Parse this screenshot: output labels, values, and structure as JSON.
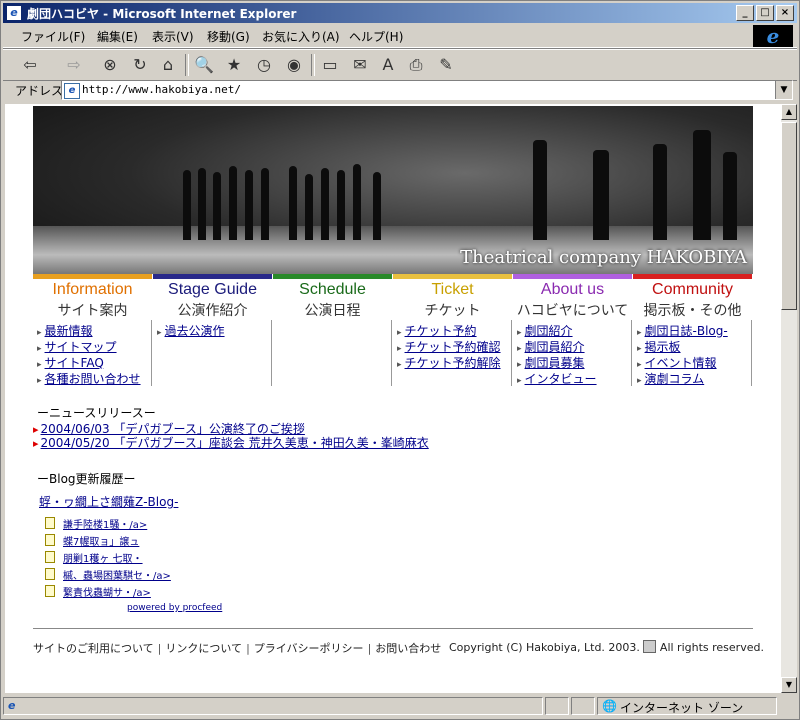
{
  "window": {
    "title": "劇団ハコビヤ - Microsoft Internet Explorer",
    "min_label": "_",
    "max_label": "□",
    "close_label": "×"
  },
  "menu": [
    "ファイル(F)",
    "編集(E)",
    "表示(V)",
    "移動(G)",
    "お気に入り(A)",
    "ヘルプ(H)"
  ],
  "address": {
    "label": "アドレス",
    "url": "http://www.hakobiya.net/"
  },
  "hero": {
    "caption": "Theatrical company HAKOBIYA"
  },
  "nav": [
    {
      "en": "Information",
      "jp": "サイト案内",
      "color": "#e07000",
      "bar": "#e8a020",
      "links": [
        "最新情報",
        "サイトマップ",
        "サイトFAQ",
        "各種お問い合わせ"
      ]
    },
    {
      "en": "Stage Guide",
      "jp": "公演作紹介",
      "color": "#1a1a7a",
      "bar": "#2a2a8a",
      "links": [
        "過去公演作"
      ]
    },
    {
      "en": "Schedule",
      "jp": "公演日程",
      "color": "#1a6a1a",
      "bar": "#2a8a2a",
      "links": []
    },
    {
      "en": "Ticket",
      "jp": "チケット",
      "color": "#c8a000",
      "bar": "#e8c040",
      "links": [
        "チケット予約",
        "チケット予約確認",
        "チケット予約解除"
      ]
    },
    {
      "en": "About us",
      "jp": "ハコビヤについて",
      "color": "#8a2ab0",
      "bar": "#b060e0",
      "links": [
        "劇団紹介",
        "劇団員紹介",
        "劇団員募集",
        "インタビュー"
      ]
    },
    {
      "en": "Community",
      "jp": "掲示板・その他",
      "color": "#c01010",
      "bar": "#d82020",
      "links": [
        "劇団日誌-Blog-",
        "掲示板",
        "イベント情報",
        "演劇コラム"
      ]
    }
  ],
  "news": {
    "heading": "ーニュースリリースー",
    "items": [
      "2004/06/03 「デパガブース」公演終了のご挨拶",
      "2004/05/20 「デパガブース」座談会  荒井久美恵・神田久美・峯崎麻衣"
    ]
  },
  "blog": {
    "heading": "ーBlog更新履歴ー",
    "title": "蜉・ヮ繝上さ繝薙Ζ-Blog-",
    "items": [
      "謙手陸楼1騒・/a>",
      "蝶7幄取ョ」譲ュ",
      "朋剿1穫ヶ 七取・",
      "槭、蟲場困葉騏セ・/a>",
      "繋責伐蟲蝴サ・/a>"
    ],
    "powered": "powered by procfeed"
  },
  "footer": {
    "links": [
      "サイトのご利用について",
      "リンクについて",
      "プライバシーポリシー",
      "お問い合わせ"
    ],
    "copyright": "Copyright (C) Hakobiya, Ltd. 2003.",
    "rights": "All rights reserved."
  },
  "status": {
    "zone": "インターネット ゾーン"
  }
}
